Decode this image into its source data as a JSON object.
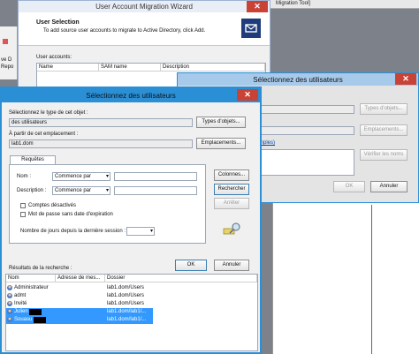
{
  "background_window": {
    "title_fragment": "Migration Tool]",
    "left_fragments": [
      "ve D",
      "Repo"
    ]
  },
  "wizard": {
    "title": "User Account Migration Wizard",
    "section_title": "User Selection",
    "section_desc": "To add source user accounts to migrate to Active Directory, click Add.",
    "list_label": "User accounts:",
    "columns": [
      "Name",
      "SAM name",
      "Description"
    ]
  },
  "secondary_dialog": {
    "title": "Sélectionnez des utilisateurs",
    "object_types_button": "Types d'objets...",
    "locations_button": "Emplacements...",
    "link_text": "mples)",
    "check_names_button": "Vérifier les noms",
    "ok_button": "OK",
    "cancel_button": "Annuler"
  },
  "dialog": {
    "title": "Sélectionnez des utilisateurs",
    "object_type_label": "Sélectionnez le type de cet objet :",
    "object_type_value": "des utilisateurs",
    "object_types_button": "Types d'objets...",
    "location_label": "À partir de cet emplacement :",
    "location_value": "lab1.dom",
    "locations_button": "Emplacements...",
    "common_queries_tab": "Requêtes communes",
    "name_label": "Nom :",
    "name_operator": "Commence par",
    "description_label": "Description :",
    "description_operator": "Commence par",
    "disabled_accounts_label": "Comptes désactivés",
    "nonexpiring_password_label": "Mot de passe sans date d'expiration",
    "days_since_logon_label": "Nombre de jours depuis la dernière session :",
    "columns_button": "Colonnes...",
    "search_button": "Rechercher",
    "stop_button": "Arrêter",
    "ok_button": "OK",
    "cancel_button": "Annuler",
    "results_label": "Résultats de la recherche :",
    "results_columns": [
      "Nom",
      "Adresse de mes...",
      "Dossier"
    ],
    "results": [
      {
        "name": "Administrateur",
        "folder": "lab1.dom/Users",
        "selected": false
      },
      {
        "name": "admt",
        "folder": "lab1.dom/Users",
        "selected": false
      },
      {
        "name": "Invité",
        "folder": "lab1.dom/Users",
        "selected": false
      },
      {
        "name": "Julien",
        "folder": "lab1.dom/lab1/...",
        "selected": true
      },
      {
        "name": "Souasu",
        "folder": "lab1.dom/lab1/...",
        "selected": true
      }
    ]
  },
  "colors": {
    "dialog_border": "#2b8fd6",
    "selection": "#3399ff",
    "close": "#c94236"
  }
}
